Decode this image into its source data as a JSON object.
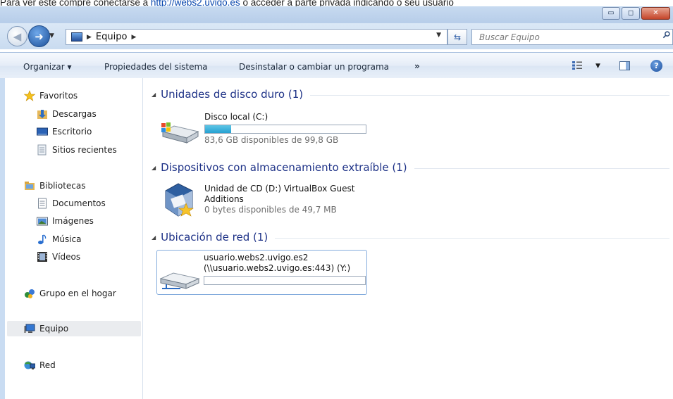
{
  "page_text": {
    "before_link": "Para ver este compre conectarse a ",
    "link": "http://webs2.uvigo.es",
    "after_link": " o acceder a parte privada indicando o seu usuario"
  },
  "window_buttons": {
    "minimize": "▭",
    "maximize": "◻",
    "close": "✕"
  },
  "address": {
    "segments": [
      "Equipo"
    ],
    "search_placeholder": "Buscar Equipo"
  },
  "commands": {
    "organizar": "Organizar ▾",
    "propiedades": "Propiedades del sistema",
    "desinstalar": "Desinstalar o cambiar un programa",
    "more": "»"
  },
  "nav": {
    "favoritos": "Favoritos",
    "descargas": "Descargas",
    "escritorio": "Escritorio",
    "sitios": "Sitios recientes",
    "bibliotecas": "Bibliotecas",
    "documentos": "Documentos",
    "imagenes": "Imágenes",
    "musica": "Música",
    "videos": "Vídeos",
    "grupo": "Grupo en el hogar",
    "equipo": "Equipo",
    "red": "Red"
  },
  "groups": {
    "discos": "Unidades de disco duro (1)",
    "extraibles": "Dispositivos con almacenamiento extraíble (1)",
    "red": "Ubicación de red (1)"
  },
  "drives": {
    "local": {
      "name": "Disco local (C:)",
      "free": "83,6 GB disponibles de 99,8 GB",
      "used_fraction": 0.162
    },
    "cd": {
      "name_line1": "Unidad de CD (D:) VirtualBox Guest",
      "name_line2": "Additions",
      "free": "0 bytes disponibles de 49,7 MB"
    },
    "net": {
      "name_line1": "usuario.webs2.uvigo.es2",
      "name_line2": "(\\\\usuario.webs2.uvigo.es:443) (Y:)",
      "used_fraction": 0
    }
  }
}
